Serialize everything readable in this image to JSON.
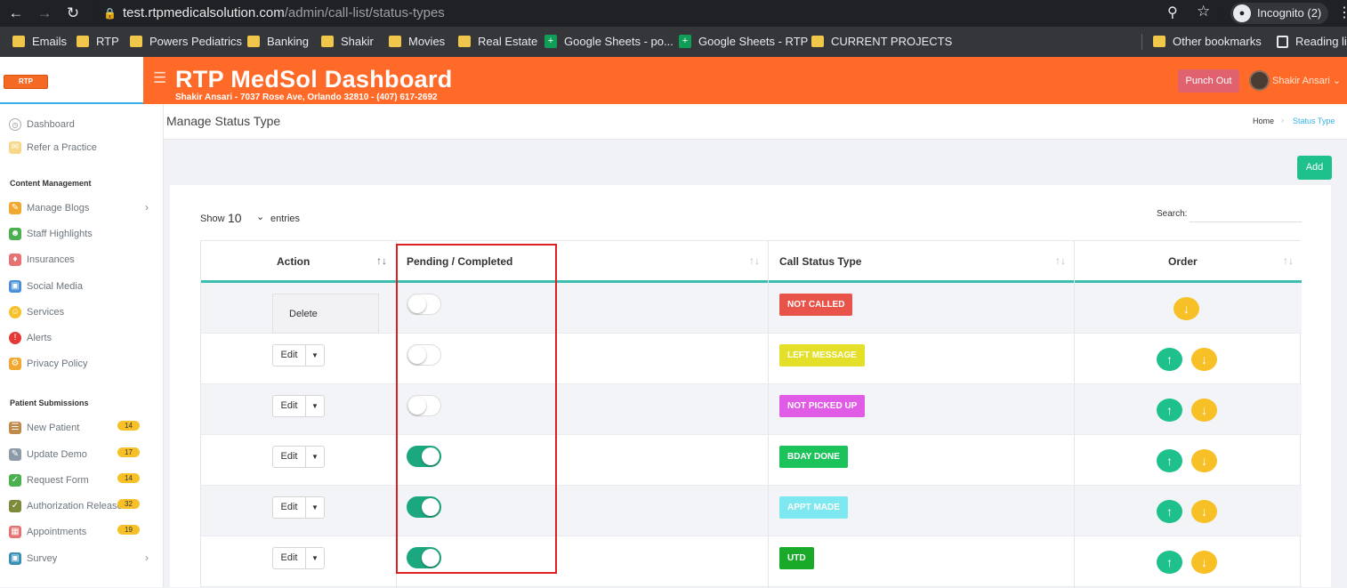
{
  "browser": {
    "url_host": "test.rtpmedicalsolution.com",
    "url_path": "/admin/call-list/status-types",
    "incognito_label": "Incognito (2)",
    "bookmarks": [
      "Emails",
      "RTP",
      "Powers Pediatrics",
      "Banking",
      "Shakir",
      "Movies",
      "Real Estate",
      "Google Sheets - po...",
      "Google Sheets - RTP",
      "CURRENT PROJECTS"
    ],
    "other_bookmarks": "Other bookmarks",
    "reading_list": "Reading lis"
  },
  "logo_text": "RTP MEDICAL SOLUTION",
  "header": {
    "title": "RTP MedSol Dashboard",
    "subtitle": "Shakir Ansari - 7037 Rose Ave, Orlando 32810 - (407) 617-2692",
    "punch_out": "Punch Out",
    "user_name": "Shakir Ansari"
  },
  "sidebar": {
    "top": [
      {
        "label": "Dashboard",
        "icon": "gauge-icon"
      },
      {
        "label": "Refer a Practice",
        "icon": "refer-icon"
      }
    ],
    "content_heading": "Content Management",
    "content": [
      {
        "label": "Manage Blogs",
        "icon": "blog-icon",
        "color": "#f0a830"
      },
      {
        "label": "Staff Highlights",
        "icon": "staff-icon",
        "color": "#4caf50"
      },
      {
        "label": "Insurances",
        "icon": "insurance-icon",
        "color": "#e57373"
      },
      {
        "label": "Social Media",
        "icon": "social-icon",
        "color": "#4a90d9"
      },
      {
        "label": "Services",
        "icon": "services-icon",
        "color": "#f6c026"
      },
      {
        "label": "Alerts",
        "icon": "alert-icon",
        "color": "#e53935"
      },
      {
        "label": "Privacy Policy",
        "icon": "privacy-icon",
        "color": "#f0a830"
      }
    ],
    "patient_heading": "Patient Submissions",
    "patient": [
      {
        "label": "New Patient",
        "badge": "14",
        "icon": "clipboard-icon"
      },
      {
        "label": "Update Demo",
        "badge": "17",
        "icon": "update-icon"
      },
      {
        "label": "Request Form",
        "badge": "14",
        "icon": "form-icon"
      },
      {
        "label": "Authorization Release",
        "badge": "32",
        "icon": "auth-icon"
      },
      {
        "label": "Appointments",
        "badge": "19",
        "icon": "calendar-icon"
      },
      {
        "label": "Survey",
        "badge": "",
        "icon": "survey-icon"
      }
    ]
  },
  "page": {
    "title": "Manage Status Type",
    "breadcrumb_home": "Home",
    "breadcrumb_current": "Status Type",
    "add_label": "Add"
  },
  "table": {
    "show_label": "Show",
    "show_value": "10",
    "entries_label": "entries",
    "search_label": "Search:",
    "columns": [
      "Action",
      "Pending / Completed",
      "Call Status Type",
      "Order"
    ],
    "edit_label": "Edit",
    "delete_label": "Delete",
    "rows": [
      {
        "status": "NOT CALLED",
        "color": "#e8544a",
        "completed": false
      },
      {
        "status": "LEFT MESSAGE",
        "color": "#e4e02a",
        "completed": false
      },
      {
        "status": "NOT PICKED UP",
        "color": "#e05ce6",
        "completed": false
      },
      {
        "status": "BDAY DONE",
        "color": "#1cc35a",
        "completed": true
      },
      {
        "status": "APPT MADE",
        "color": "#7ee8f0",
        "completed": true
      },
      {
        "status": "UTD",
        "color": "#1aaa2a",
        "completed": true
      }
    ]
  }
}
